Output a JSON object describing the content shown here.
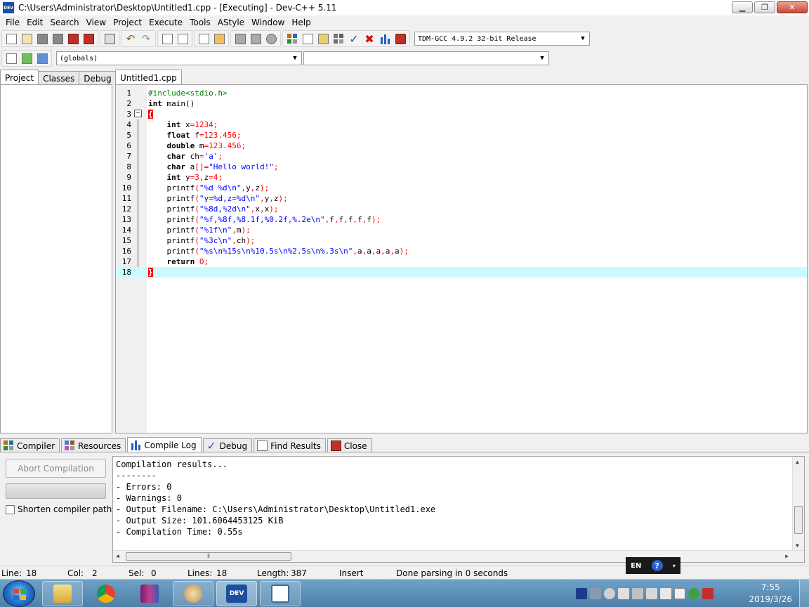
{
  "window": {
    "title": "C:\\Users\\Administrator\\Desktop\\Untitled1.cpp - [Executing] - Dev-C++ 5.11",
    "icon_text": "DEV",
    "controls": {
      "minimize": "▁",
      "maximize": "❐",
      "close": "✕"
    }
  },
  "menu": [
    "File",
    "Edit",
    "Search",
    "View",
    "Project",
    "Execute",
    "Tools",
    "AStyle",
    "Window",
    "Help"
  ],
  "toolbar": {
    "compiler_select": "TDM-GCC 4.9.2 32-bit Release",
    "scope_select": "(globals)",
    "function_select": ""
  },
  "left_panel": {
    "tabs": [
      "Project",
      "Classes",
      "Debug"
    ],
    "active_tab": "Project"
  },
  "editor": {
    "tab": "Untitled1.cpp",
    "highlight_line": 18,
    "lines": [
      {
        "n": "1",
        "html": "<span class=\"pp\">#include&lt;stdio.h&gt;</span>"
      },
      {
        "n": "2",
        "html": "<span class=\"kw\">int</span> main()"
      },
      {
        "n": "3",
        "html": "<span class=\"brace\">{</span>"
      },
      {
        "n": "4",
        "html": "    <span class=\"kw\">int</span> x<span class=\"sym\">=</span><span class=\"num\">1234</span><span class=\"sym\">;</span>"
      },
      {
        "n": "5",
        "html": "    <span class=\"kw\">float</span> f<span class=\"sym\">=</span><span class=\"num\">123.456</span><span class=\"sym\">;</span>"
      },
      {
        "n": "6",
        "html": "    <span class=\"kw\">double</span> m<span class=\"sym\">=</span><span class=\"num\">123.456</span><span class=\"sym\">;</span>"
      },
      {
        "n": "7",
        "html": "    <span class=\"kw\">char</span> ch<span class=\"sym\">=</span><span class=\"str\">'a'</span><span class=\"sym\">;</span>"
      },
      {
        "n": "8",
        "html": "    <span class=\"kw\">char</span> a<span class=\"sym\">[]=</span><span class=\"str\">\"Hello world!\"</span><span class=\"sym\">;</span>"
      },
      {
        "n": "9",
        "html": "    <span class=\"kw\">int</span> y<span class=\"sym\">=</span><span class=\"num\">3</span><span class=\"sym\">,</span>z<span class=\"sym\">=</span><span class=\"num\">4</span><span class=\"sym\">;</span>"
      },
      {
        "n": "10",
        "html": "    printf<span class=\"sym\">(</span><span class=\"str\">\"%d %d\\n\"</span><span class=\"sym\">,</span>y<span class=\"sym\">,</span>z<span class=\"sym\">);</span>"
      },
      {
        "n": "11",
        "html": "    printf<span class=\"sym\">(</span><span class=\"str\">\"y=%d,z=%d\\n\"</span><span class=\"sym\">,</span>y<span class=\"sym\">,</span>z<span class=\"sym\">);</span>"
      },
      {
        "n": "12",
        "html": "    printf<span class=\"sym\">(</span><span class=\"str\">\"%8d,%2d\\n\"</span><span class=\"sym\">,</span>x<span class=\"sym\">,</span>x<span class=\"sym\">);</span>"
      },
      {
        "n": "13",
        "html": "    printf<span class=\"sym\">(</span><span class=\"str\">\"%f,%8f,%8.1f,%0.2f,%.2e\\n\"</span><span class=\"sym\">,</span>f<span class=\"sym\">,</span>f<span class=\"sym\">,</span>f<span class=\"sym\">,</span>f<span class=\"sym\">,</span>f<span class=\"sym\">);</span>"
      },
      {
        "n": "14",
        "html": "    printf<span class=\"sym\">(</span><span class=\"str\">\"%1f\\n\"</span><span class=\"sym\">,</span>m<span class=\"sym\">);</span>"
      },
      {
        "n": "15",
        "html": "    printf<span class=\"sym\">(</span><span class=\"str\">\"%3c\\n\"</span><span class=\"sym\">,</span>ch<span class=\"sym\">);</span>"
      },
      {
        "n": "16",
        "html": "    printf<span class=\"sym\">(</span><span class=\"str\">\"%s\\n%15s\\n%10.5s\\n%2.5s\\n%.3s\\n\"</span><span class=\"sym\">,</span>a<span class=\"sym\">,</span>a<span class=\"sym\">,</span>a<span class=\"sym\">,</span>a<span class=\"sym\">,</span>a<span class=\"sym\">);</span>"
      },
      {
        "n": "17",
        "html": "    <span class=\"kw\">return</span> <span class=\"num\">0</span><span class=\"sym\">;</span>"
      },
      {
        "n": "18",
        "html": "<span class=\"brace\">}</span>"
      }
    ]
  },
  "bottom": {
    "tabs": [
      {
        "label": "Compiler",
        "icon": "grid-icon"
      },
      {
        "label": "Resources",
        "icon": "resources-icon"
      },
      {
        "label": "Compile Log",
        "icon": "chart-icon"
      },
      {
        "label": "Debug",
        "icon": "check-icon"
      },
      {
        "label": "Find Results",
        "icon": "find-icon"
      },
      {
        "label": "Close",
        "icon": "close-panel-icon"
      }
    ],
    "active_tab": "Compile Log",
    "abort_label": "Abort Compilation",
    "progress": 0,
    "shorten_label": "Shorten compiler paths",
    "shorten_checked": false,
    "log": [
      "Compilation results...",
      "--------",
      "- Errors: 0",
      "- Warnings: 0",
      "- Output Filename: C:\\Users\\Administrator\\Desktop\\Untitled1.exe",
      "- Output Size: 101.6064453125 KiB",
      "- Compilation Time: 0.55s"
    ]
  },
  "status": {
    "line_label": "Line:",
    "line": "18",
    "col_label": "Col:",
    "col": "2",
    "sel_label": "Sel:",
    "sel": "0",
    "lines_label": "Lines:",
    "lines": "18",
    "length_label": "Length:",
    "length": "387",
    "mode": "Insert",
    "message": "Done parsing in 0 seconds"
  },
  "ime": {
    "lang": "EN",
    "help": "?"
  },
  "taskbar": {
    "time": "7:55",
    "date": "2019/3/26",
    "apps": [
      "explorer",
      "chrome",
      "winrar",
      "paint",
      "devcpp",
      "notepad"
    ]
  }
}
